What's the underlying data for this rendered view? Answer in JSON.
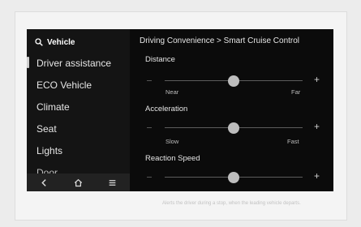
{
  "sidebar": {
    "search_label": "Vehicle",
    "items": [
      {
        "label": "Driver assistance"
      },
      {
        "label": "ECO Vehicle"
      },
      {
        "label": "Climate"
      },
      {
        "label": "Seat"
      },
      {
        "label": "Lights"
      },
      {
        "label": "Door"
      }
    ],
    "bottom_icons": [
      "back-icon",
      "home-icon",
      "menu-icon"
    ]
  },
  "breadcrumb": "Driving Convenience > Smart Cruise Control",
  "settings": [
    {
      "title": "Distance",
      "min_label": "Near",
      "max_label": "Far",
      "level": 0.5
    },
    {
      "title": "Acceleration",
      "min_label": "Slow",
      "max_label": "Fast",
      "level": 0.5
    },
    {
      "title": "Reaction Speed",
      "min_label": "",
      "max_label": "",
      "level": 0.5
    }
  ],
  "caption": "Alerts the driver during a stop, when the leading vehicle departs."
}
